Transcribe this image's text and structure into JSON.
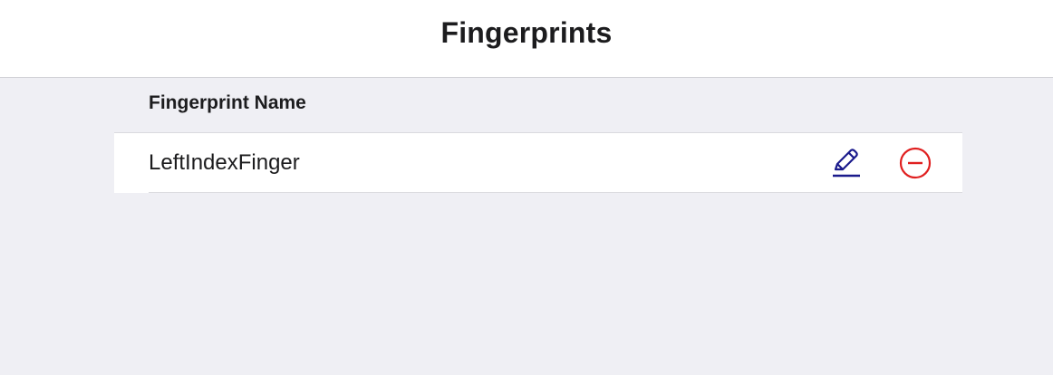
{
  "header": {
    "title": "Fingerprints"
  },
  "section": {
    "header": "Fingerprint Name"
  },
  "fingerprints": [
    {
      "name": "LeftIndexFinger",
      "edit_icon": "pencil-icon",
      "delete_icon": "minus-circle-icon"
    }
  ],
  "colors": {
    "edit_icon": "#1a1a8c",
    "delete_icon": "#e02020",
    "background": "#efeff4",
    "header_background": "#ffffff"
  }
}
